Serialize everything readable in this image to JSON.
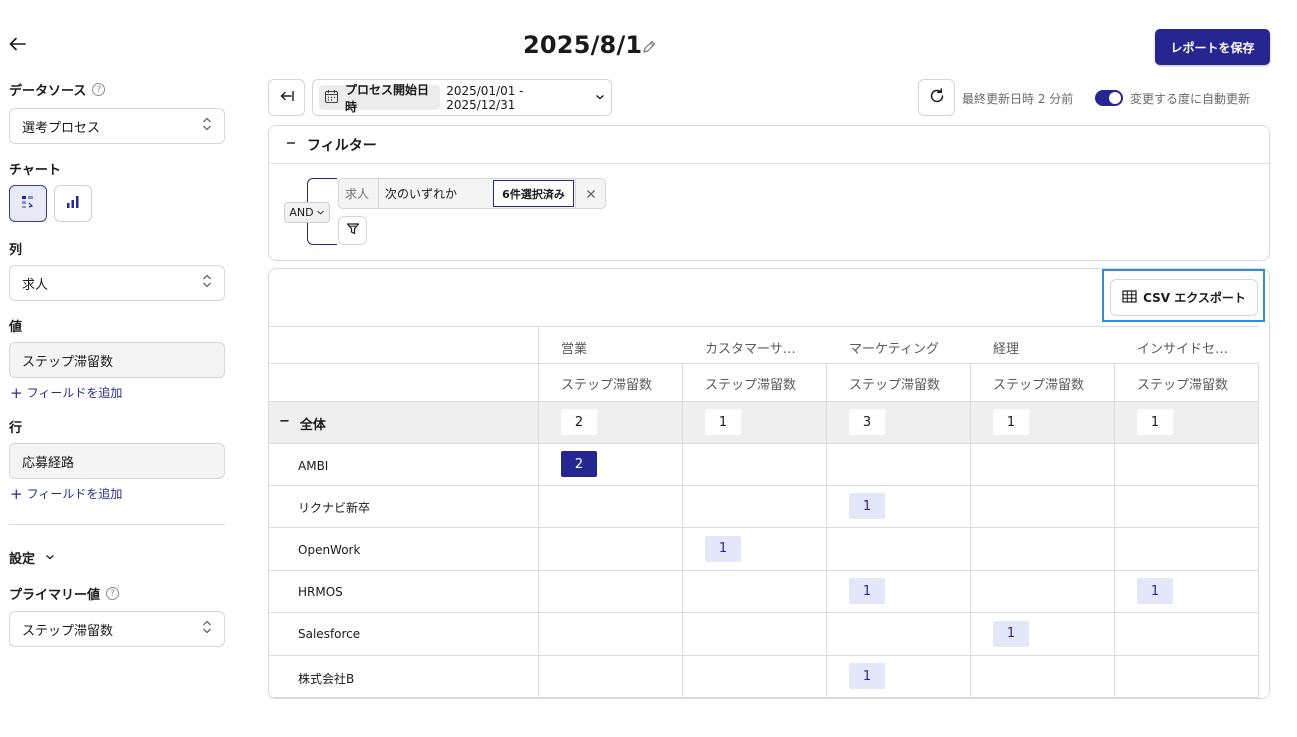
{
  "header": {
    "title": "2025/8/1",
    "save_label": "レポートを保存"
  },
  "sidebar": {
    "data_source_label": "データソース",
    "data_source_value": "選考プロセス",
    "chart_label": "チャート",
    "columns_label": "列",
    "columns_value": "求人",
    "values_label": "値",
    "values_value": "ステップ滞留数",
    "add_field_1": "フィールドを追加",
    "rows_label": "行",
    "rows_value": "応募経路",
    "add_field_2": "フィールドを追加",
    "settings_label": "設定",
    "primary_label": "プライマリー値",
    "primary_value": "ステップ滞留数"
  },
  "toolbar": {
    "date_field": "プロセス開始日時",
    "date_range": "2025/01/01 - 2025/12/31",
    "updated": "最終更新日時 2 分前",
    "auto_update": "変更する度に自動更新"
  },
  "filter": {
    "title": "フィルター",
    "and_label": "AND",
    "field": "求人",
    "operator": "次のいずれか",
    "value": "6件選択済み"
  },
  "table": {
    "export_label": "CSV エクスポート",
    "columns": [
      "営業",
      "カスタマーサ…",
      "マーケティング",
      "経理",
      "インサイドセ…"
    ],
    "metric": "ステップ滞留数",
    "total_label": "全体",
    "totals": [
      "2",
      "1",
      "3",
      "1",
      "1"
    ],
    "rows": [
      {
        "label": "AMBI",
        "values": [
          "2",
          "",
          "",
          "",
          ""
        ]
      },
      {
        "label": "リクナビ新卒",
        "values": [
          "",
          "",
          "1",
          "",
          ""
        ]
      },
      {
        "label": "OpenWork",
        "values": [
          "",
          "1",
          "",
          "",
          ""
        ]
      },
      {
        "label": "HRMOS",
        "values": [
          "",
          "",
          "1",
          "",
          "1"
        ]
      },
      {
        "label": "Salesforce",
        "values": [
          "",
          "",
          "",
          "1",
          ""
        ]
      },
      {
        "label": "株式会社B",
        "values": [
          "",
          "",
          "1",
          "",
          ""
        ]
      }
    ]
  },
  "colors": {
    "accent": "#262691",
    "highlight": "#2b8fe8",
    "cell_light": "#e4e7fa"
  },
  "icons": [
    "back-arrow-icon",
    "pencil-icon",
    "collapse-icon",
    "calendar-icon",
    "chevron-down-icon",
    "refresh-icon",
    "minus-icon",
    "close-icon",
    "funnel-icon",
    "table-icon",
    "help-icon",
    "pivot-table-icon",
    "bar-chart-icon",
    "plus-icon",
    "sort-updown-icon"
  ]
}
